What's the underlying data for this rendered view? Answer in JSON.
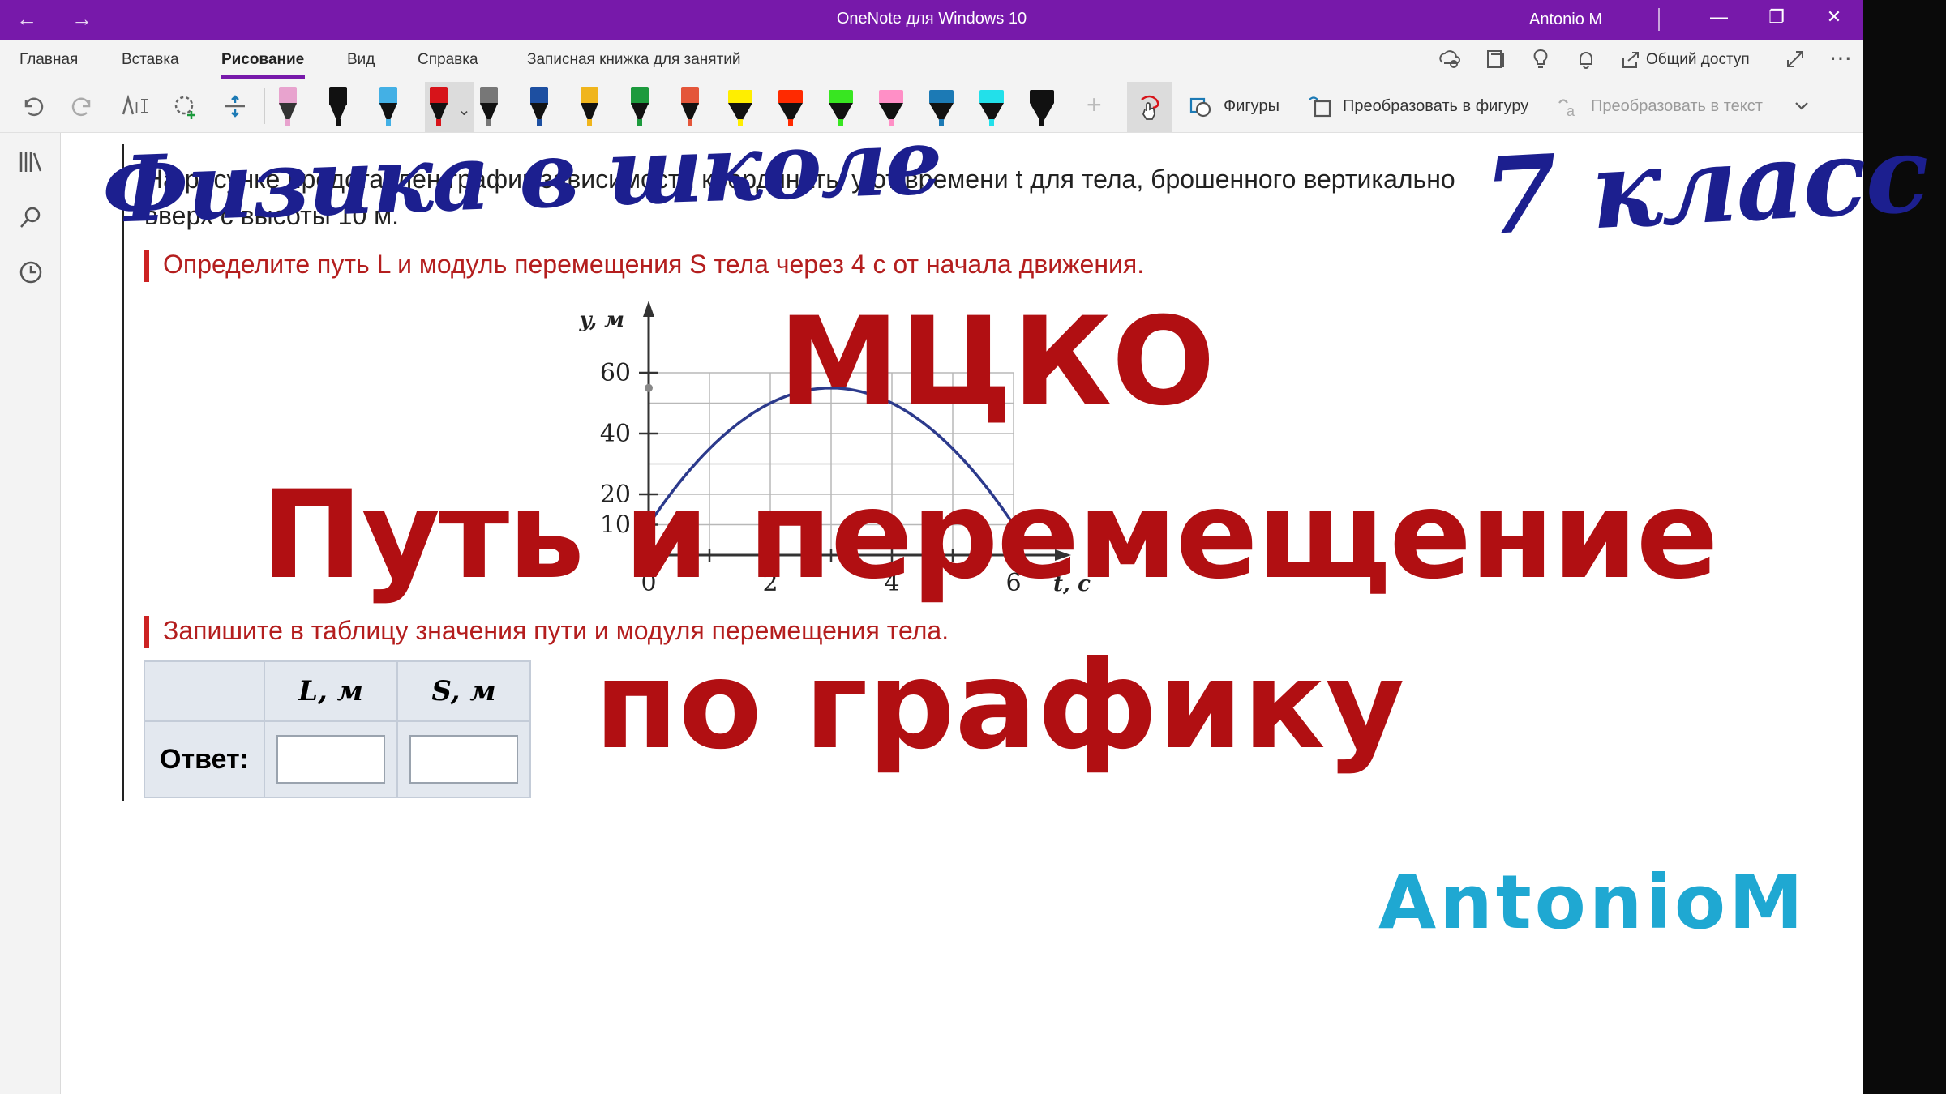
{
  "window": {
    "title": "OneNote для Windows 10",
    "user": "Antonio M",
    "back_glyph": "←",
    "forward_glyph": "→",
    "minimize_glyph": "—",
    "restore_glyph": "❐",
    "close_glyph": "✕"
  },
  "menu": {
    "items": [
      "Главная",
      "Вставка",
      "Рисование",
      "Вид",
      "Справка",
      "Записная книжка для занятий"
    ],
    "active": "Рисование",
    "share_label": "Общий доступ"
  },
  "toolbar": {
    "shapes_label": "Фигуры",
    "to_shape_label": "Преобразовать в фигуру",
    "to_text_label": "Преобразовать в текст",
    "pens": [
      {
        "cap": "#e8a3ce",
        "kind": "eraser"
      },
      {
        "cap": "#111111",
        "kind": "pen"
      },
      {
        "cap": "#43b0e5",
        "kind": "pen"
      },
      {
        "cap": "#d7141a",
        "kind": "pen",
        "selected": true
      },
      {
        "cap": "#777777",
        "kind": "pen"
      },
      {
        "cap": "#1d4fa1",
        "kind": "pen"
      },
      {
        "cap": "#f0b51c",
        "kind": "pen"
      },
      {
        "cap": "#1c9a3d",
        "kind": "pen"
      },
      {
        "cap": "#e4563a",
        "kind": "pen"
      },
      {
        "cap": "#ffee00",
        "kind": "highlighter"
      },
      {
        "cap": "#ff2a00",
        "kind": "highlighter"
      },
      {
        "cap": "#38e621",
        "kind": "highlighter"
      },
      {
        "cap": "#ff8fc6",
        "kind": "highlighter"
      },
      {
        "cap": "#1c7ab5",
        "kind": "highlighter"
      },
      {
        "cap": "#22e0ea",
        "kind": "highlighter"
      },
      {
        "cap": "#111111",
        "kind": "highlighter"
      }
    ]
  },
  "page": {
    "task_line1": "На рисунке представлен график зависимости координаты y от времени t для тела, брошенного вертикально",
    "task_line2": "вверх с высоты 10 м.",
    "question1": "Определите путь L и модуль перемещения S тела через 4 с от начала движения.",
    "question2": "Запишите в таблицу значения пути и модуля перемещения тела.",
    "table": {
      "col_L": "L, м",
      "col_S": "S, м",
      "row_label": "Ответ:",
      "value_L": "",
      "value_S": ""
    }
  },
  "overlay": {
    "script_left": "Физика в школе",
    "script_right": "7 класс",
    "line1": "МЦКО",
    "line2": "Путь и перемещение",
    "line3": "по графику",
    "brand": "AntonioM"
  },
  "chart_data": {
    "type": "line",
    "ylabel": "y, м",
    "xlabel": "t, с",
    "y_ticks": [
      10,
      20,
      40,
      60
    ],
    "x_ticks": [
      0,
      2,
      4,
      6
    ],
    "xlim": [
      0,
      7
    ],
    "ylim": [
      0,
      70
    ],
    "series": [
      {
        "x": [
          0,
          1,
          2,
          3,
          4,
          5,
          6
        ],
        "y": [
          10,
          35,
          50,
          55,
          50,
          35,
          10
        ]
      }
    ]
  }
}
